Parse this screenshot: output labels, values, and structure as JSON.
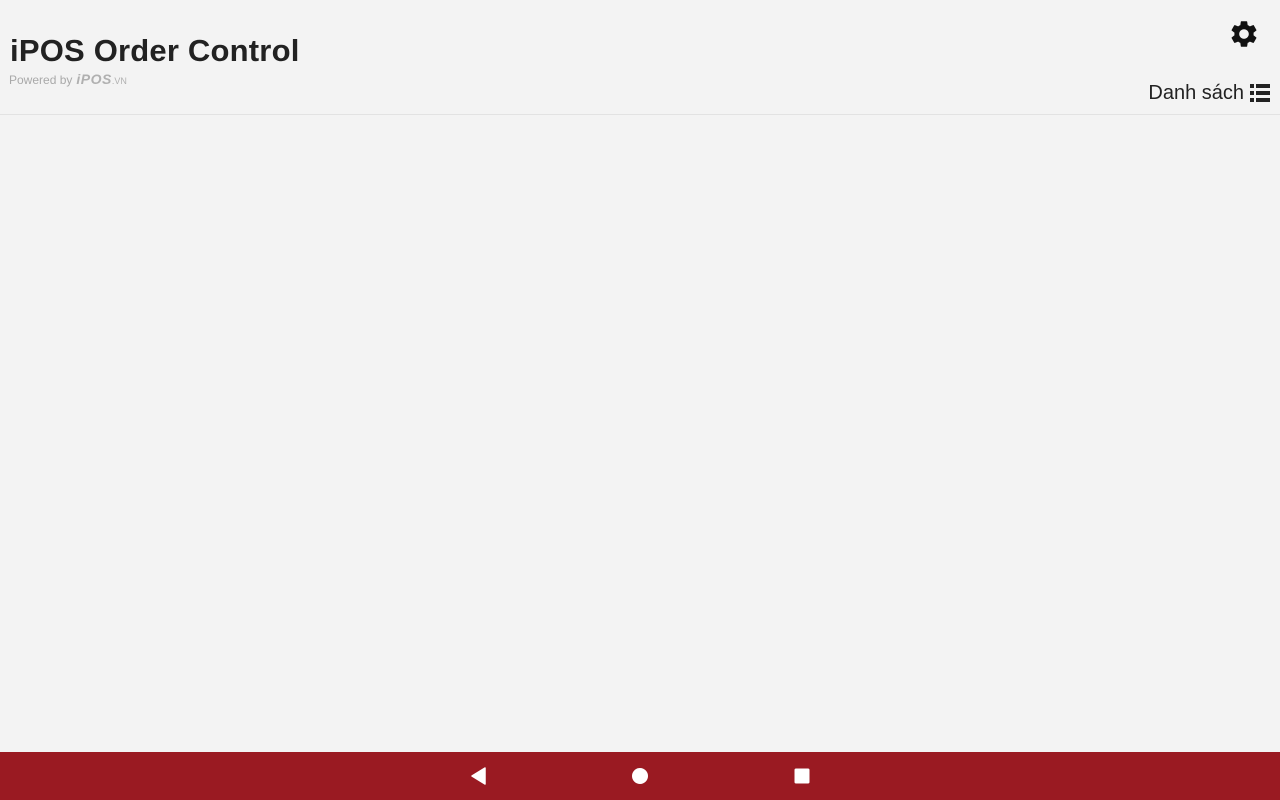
{
  "header": {
    "title": "iPOS Order Control",
    "powered_by": "Powered by",
    "brand": "iPOS",
    "brand_suffix": ".VN",
    "settings_icon": "gear-icon",
    "list_label": "Danh sách",
    "list_icon": "list-icon"
  },
  "navbar": {
    "color": "#9a1a22",
    "back_icon": "back-triangle-icon",
    "home_icon": "home-circle-icon",
    "recents_icon": "recents-square-icon"
  }
}
